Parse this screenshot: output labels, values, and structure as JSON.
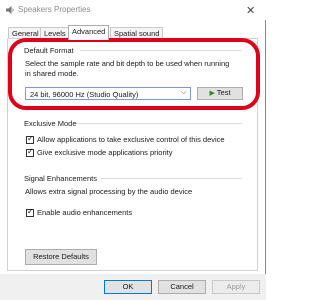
{
  "window": {
    "title": "Speakers Properties",
    "close_glyph": "✕"
  },
  "tabs": [
    {
      "label": "General"
    },
    {
      "label": "Levels"
    },
    {
      "label": "Advanced",
      "active": true
    },
    {
      "label": "Spatial sound"
    }
  ],
  "default_format": {
    "heading": "Default Format",
    "description_line1": "Select the sample rate and bit depth to be used when running",
    "description_line2": "in shared mode.",
    "selected_format": "24 bit, 96000 Hz (Studio Quality)",
    "test_label": "Test"
  },
  "exclusive_mode": {
    "heading": "Exclusive Mode",
    "allow_control_label": "Allow applications to take exclusive control of this device",
    "allow_control_checked": true,
    "priority_label": "Give exclusive mode applications priority",
    "priority_checked": true
  },
  "signal_enhancements": {
    "heading": "Signal Enhancements",
    "description": "Allows extra signal processing by the audio device",
    "enable_label": "Enable audio enhancements",
    "enable_checked": true
  },
  "buttons": {
    "restore_defaults": "Restore Defaults",
    "ok": "OK",
    "cancel": "Cancel",
    "apply": "Apply"
  },
  "colors": {
    "highlight_ring": "#e0001a",
    "test_play": "#2f8a2f"
  }
}
